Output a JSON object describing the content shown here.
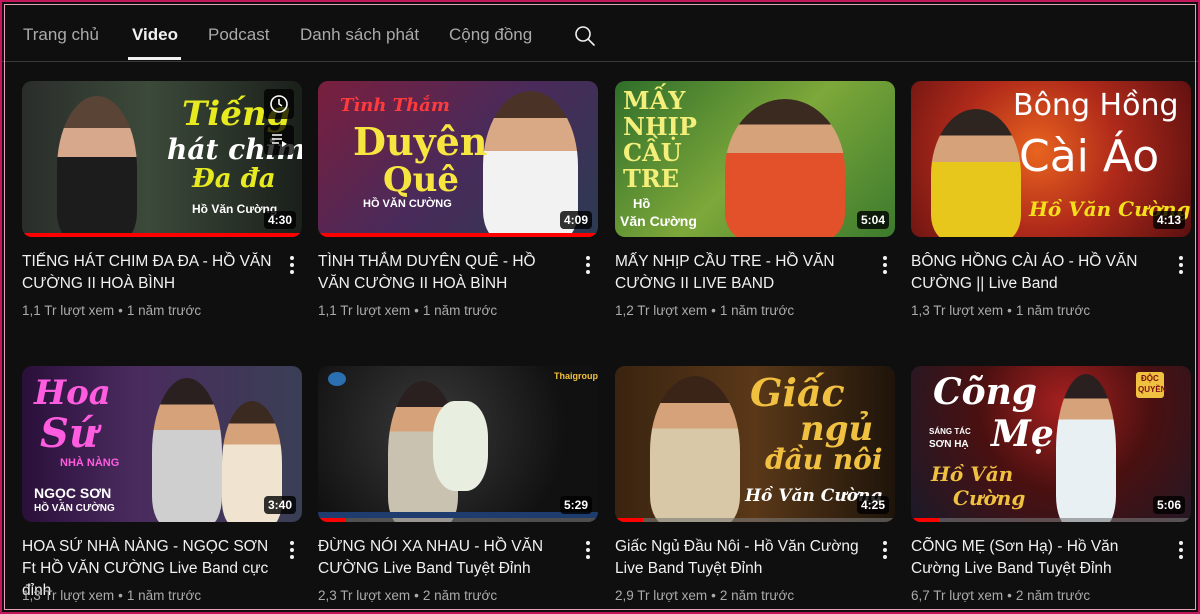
{
  "tabs": [
    {
      "label": "Trang chủ"
    },
    {
      "label": "Video"
    },
    {
      "label": "Podcast"
    },
    {
      "label": "Danh sách phát"
    },
    {
      "label": "Cộng đồng"
    }
  ],
  "active_tab": "Video",
  "videos": [
    {
      "title": "TIẾNG HÁT CHIM ĐA ĐA - HỒ VĂN CƯỜNG II HOÀ BÌNH",
      "views": "1,1 Tr lượt xem",
      "age": "1 năm trước",
      "duration": "4:30",
      "progress": 1.0,
      "thumb_text": [
        "Tiếng",
        "hát chim",
        "Đa đa",
        "Hồ Văn Cường"
      ]
    },
    {
      "title": "TÌNH THẮM DUYÊN QUÊ - HỒ VĂN CƯỜNG II HOÀ BÌNH",
      "views": "1,1 Tr lượt xem",
      "age": "1 năm trước",
      "duration": "4:09",
      "progress": 1.0,
      "thumb_text": [
        "Tình Thắm",
        "Duyên",
        "Quê",
        "HỒ VĂN CƯỜNG"
      ]
    },
    {
      "title": "MẤY NHỊP CẦU TRE - HỒ VĂN CƯỜNG II LIVE BAND",
      "views": "1,2 Tr lượt xem",
      "age": "1 năm trước",
      "duration": "5:04",
      "progress": 0,
      "thumb_text": [
        "MẤY",
        "NHỊP",
        "CẦU",
        "TRE",
        "Hồ",
        "Văn Cường"
      ]
    },
    {
      "title": "BÔNG HỒNG CÀI ÁO - HỒ VĂN CƯỜNG || Live Band",
      "views": "1,3 Tr lượt xem",
      "age": "1 năm trước",
      "duration": "4:13",
      "progress": 0,
      "thumb_text": [
        "Bông Hồng",
        "Cài Áo",
        "Hồ Văn Cường"
      ]
    },
    {
      "title": "HOA SỨ NHÀ NÀNG - NGỌC SƠN Ft HỒ VĂN CƯỜNG Live Band cực đỉnh",
      "views": "1,3 Tr lượt xem",
      "age": "1 năm trước",
      "duration": "3:40",
      "progress": 0,
      "thumb_text": [
        "Hoa",
        "Sứ",
        "NHÀ NÀNG",
        "NGỌC SƠN",
        "HỒ VĂN CƯỜNG"
      ]
    },
    {
      "title": "ĐỪNG NÓI XA NHAU - HỒ VĂN CƯỜNG Live Band Tuyệt Đỉnh",
      "views": "2,3 Tr lượt xem",
      "age": "2 năm trước",
      "duration": "5:29",
      "progress": 0.1,
      "thumb_text": [
        "Thaigroup"
      ]
    },
    {
      "title": "Giấc Ngủ Đầu Nôi - Hồ Văn Cường Live Band Tuyệt Đỉnh",
      "views": "2,9 Tr lượt xem",
      "age": "2 năm trước",
      "duration": "4:25",
      "progress": 0.1,
      "thumb_text": [
        "Giấc",
        "ngủ",
        "đầu nôi",
        "Hồ Văn Cường"
      ]
    },
    {
      "title": "CÕNG MẸ (Sơn Hạ) - Hồ Văn Cường Live Band Tuyệt Đỉnh",
      "views": "6,7 Tr lượt xem",
      "age": "2 năm trước",
      "duration": "5:06",
      "progress": 0.1,
      "thumb_text": [
        "Cõng",
        "Mẹ",
        "SÁNG TÁC",
        "SƠN HẠ",
        "Hồ Văn",
        "Cường",
        "ĐỘC",
        "QUYỀN"
      ]
    }
  ],
  "icons": {
    "search": "search-icon",
    "clock": "watch-later-icon",
    "queue": "add-to-queue-icon",
    "menu": "more-vert-icon"
  },
  "colors": {
    "background": "#0f0f0f",
    "text": "#f1f1f1",
    "secondary_text": "#aaaaaa",
    "progress": "#ff0000"
  }
}
